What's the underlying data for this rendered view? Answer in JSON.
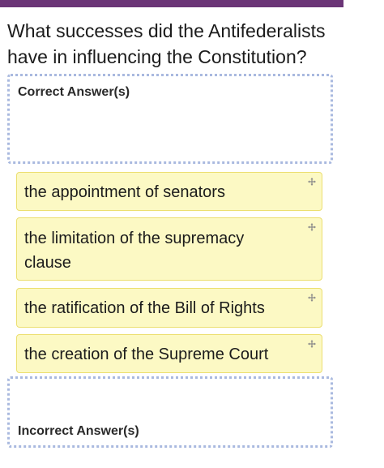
{
  "question": {
    "text": "What successes did the Antifederalists have in influencing the Constitution?"
  },
  "zones": {
    "correct_label": "Correct Answer(s)",
    "incorrect_label": "Incorrect Answer(s)"
  },
  "answers": [
    {
      "text": "the appointment of senators",
      "icon": "drag-handle-icon"
    },
    {
      "text": "the limitation of the supremacy clause",
      "icon": "drag-handle-icon"
    },
    {
      "text": "the ratification of the Bill of Rights",
      "icon": "drag-handle-icon"
    },
    {
      "text": "the creation of the Supreme Court",
      "icon": "drag-handle-icon"
    }
  ],
  "colors": {
    "top_bar": "#6b3577",
    "card_background": "#fcf9c4",
    "card_border": "#ecdf70",
    "drop_zone_border": "#a9b9df"
  }
}
